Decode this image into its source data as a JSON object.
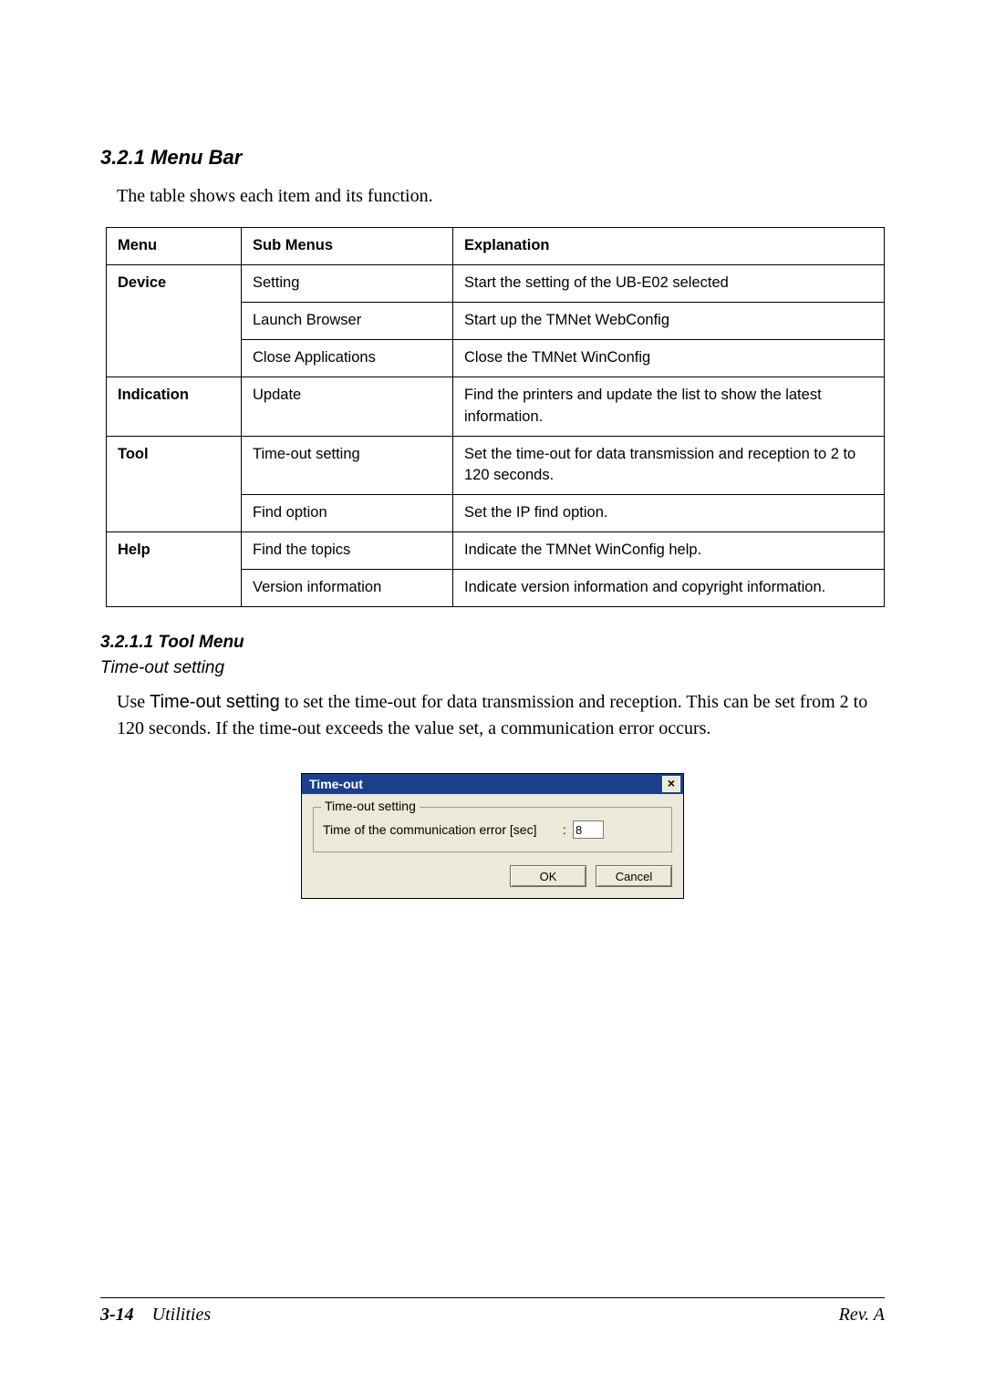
{
  "headings": {
    "section": "3.2.1  Menu Bar",
    "intro": "The table shows each item and its function.",
    "subsection": "3.2.1.1 Tool Menu",
    "subsub": "Time-out setting"
  },
  "table": {
    "headers": {
      "menu": "Menu",
      "sub": "Sub Menus",
      "exp": "Explanation"
    },
    "rows": [
      {
        "menu": "Device",
        "sub": "Setting",
        "exp": "Start the setting of the UB-E02 selected",
        "menuRowspan": 3
      },
      {
        "menu": "",
        "sub": "Launch Browser",
        "exp": "Start up the TMNet WebConfig"
      },
      {
        "menu": "",
        "sub": "Close Applications",
        "exp": "Close the TMNet WinConfig"
      },
      {
        "menu": "Indication",
        "sub": "Update",
        "exp": "Find the printers and update the list to show the latest information.",
        "menuRowspan": 1
      },
      {
        "menu": "Tool",
        "sub": "Time-out setting",
        "exp": "Set the time-out for data transmission and reception to 2 to 120 seconds.",
        "menuRowspan": 2
      },
      {
        "menu": "",
        "sub": "Find option",
        "exp": "Set the IP find option."
      },
      {
        "menu": "Help",
        "sub": "Find the topics",
        "exp": "Indicate the TMNet WinConfig help.",
        "menuRowspan": 2
      },
      {
        "menu": "",
        "sub": "Version information",
        "exp": "Indicate version information and copyright information."
      }
    ]
  },
  "paragraph": {
    "pre": "Use ",
    "sans": "Time-out setting",
    "post": " to set the time-out for data transmission and reception. This can be set from 2 to 120 seconds. If the time-out exceeds the value set, a communication error occurs."
  },
  "dialog": {
    "title": "Time-out",
    "close_glyph": "×",
    "legend": "Time-out setting",
    "field_label": "Time of the communication error [sec]",
    "colon": ":",
    "value": "8",
    "ok": "OK",
    "cancel": "Cancel"
  },
  "footer": {
    "page": "3-14",
    "section": "Utilities",
    "rev": "Rev. A"
  }
}
